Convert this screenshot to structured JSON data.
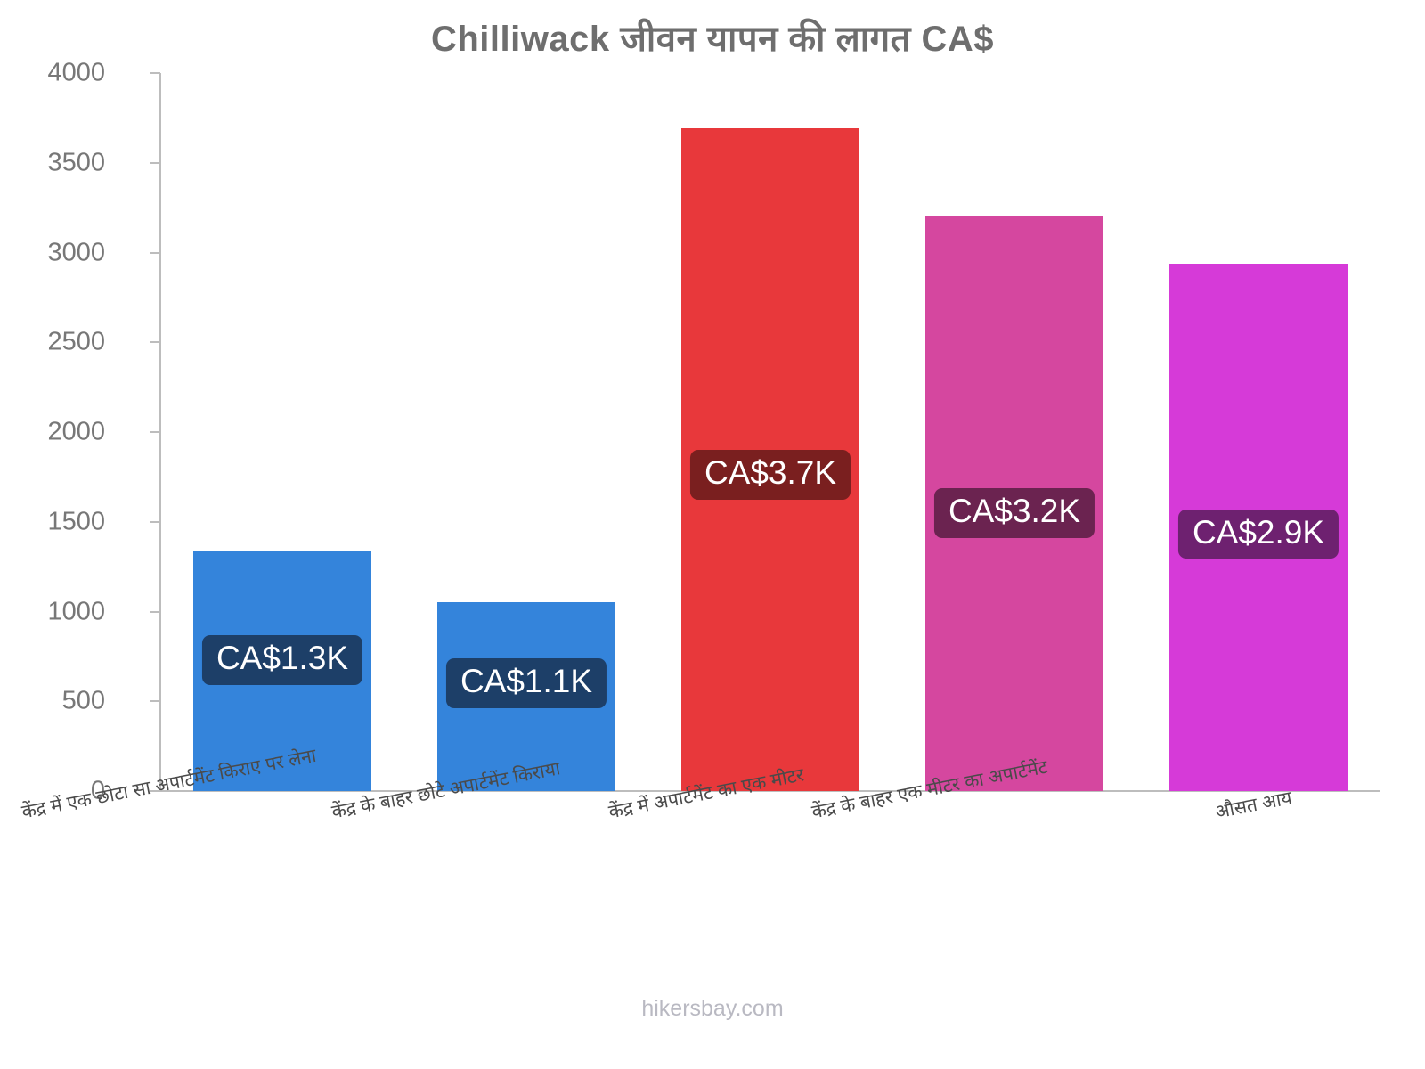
{
  "title": "Chilliwack जीवन यापन की लागत CA$",
  "footer": {
    "credit": "hikersbay.com"
  },
  "chart_data": {
    "type": "bar",
    "title": "Chilliwack जीवन यापन की लागत CA$",
    "xlabel": "",
    "ylabel": "",
    "ylim": [
      0,
      4000
    ],
    "grid": false,
    "legend": "none",
    "currency": "CA$",
    "yticks": [
      {
        "value": 4000,
        "label": "4000"
      },
      {
        "value": 3500,
        "label": "3500"
      },
      {
        "value": 3000,
        "label": "3000"
      },
      {
        "value": 2500,
        "label": "2500"
      },
      {
        "value": 2000,
        "label": "2000"
      },
      {
        "value": 1500,
        "label": "1500"
      },
      {
        "value": 1000,
        "label": "1000"
      },
      {
        "value": 500,
        "label": "500"
      },
      {
        "value": 0,
        "label": "0"
      }
    ],
    "categories": [
      "केंद्र में एक छोटा सा अपार्टमेंट किराए पर लेना",
      "केंद्र के बाहर छोटे अपार्टमेंट किराया",
      "केंद्र में अपार्टमेंट का एक मीटर",
      "केंद्र के बाहर एक मीटर का अपार्टमेंट",
      "औसत आय"
    ],
    "values": [
      1340,
      1050,
      3690,
      3200,
      2940
    ],
    "value_labels": [
      "CA$1.3K",
      "CA$1.1K",
      "CA$3.7K",
      "CA$3.2K",
      "CA$2.9K"
    ],
    "bar_colors": [
      "#3484db",
      "#3484db",
      "#e8383b",
      "#d5479f",
      "#d63ad8"
    ],
    "badge_colors": [
      "#1d3f68",
      "#1d3f68",
      "#7a1f1f",
      "#6b2350",
      "#6e2170"
    ]
  }
}
